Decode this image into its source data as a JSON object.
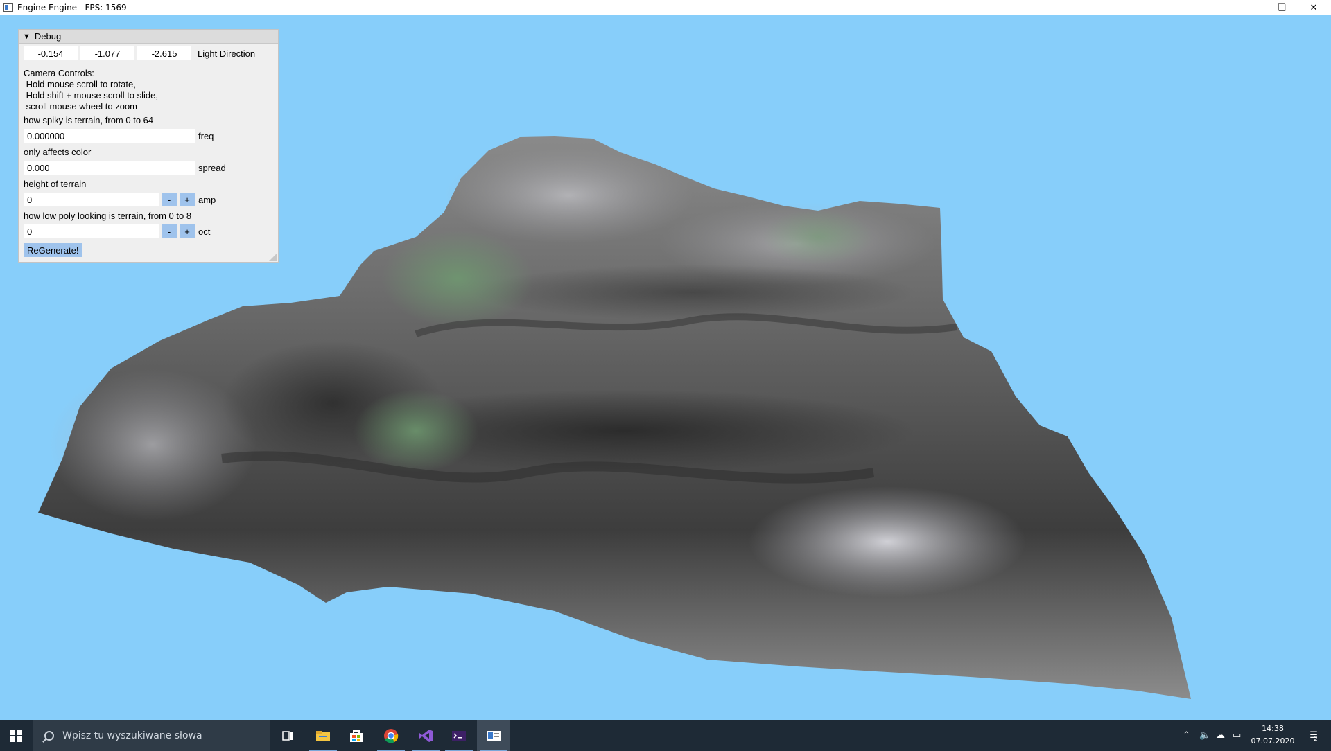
{
  "window": {
    "title": "Engine Engine   FPS: 1569",
    "min_icon": "minimize-icon",
    "max_icon": "restore-icon",
    "close_icon": "close-icon"
  },
  "scene": {
    "sky_color": "#87cefa",
    "terrain": "grey low-poly terrain mesh with green tinted patches"
  },
  "debug": {
    "title": "Debug",
    "light_direction": {
      "x": "-0.154",
      "y": "-1.077",
      "z": "-2.615",
      "label": "Light Direction"
    },
    "camera_controls": "Camera Controls:\n Hold mouse scroll to rotate,\n Hold shift + mouse scroll to slide,\n scroll mouse wheel to zoom",
    "freq": {
      "caption": "how spiky is terrain, from 0 to 64",
      "value": "0.000000",
      "label": "freq"
    },
    "spread": {
      "caption": "only affects color",
      "value": "0.000",
      "label": "spread"
    },
    "amp": {
      "caption": "height of terrain",
      "value": "0",
      "minus": "-",
      "plus": "+",
      "label": "amp"
    },
    "oct": {
      "caption": "how low poly looking is terrain, from 0 to 8",
      "value": "0",
      "minus": "-",
      "plus": "+",
      "label": "oct"
    },
    "regenerate": "ReGenerate!"
  },
  "taskbar": {
    "search_placeholder": "Wpisz tu wyszukiwane słowa",
    "time": "14:38",
    "date": "07.07.2020",
    "notifications": "2",
    "apps": [
      "task-view-icon",
      "file-explorer-icon",
      "store-icon",
      "chrome-icon",
      "visual-studio-icon",
      "terminal-icon",
      "engine-app-icon"
    ]
  }
}
